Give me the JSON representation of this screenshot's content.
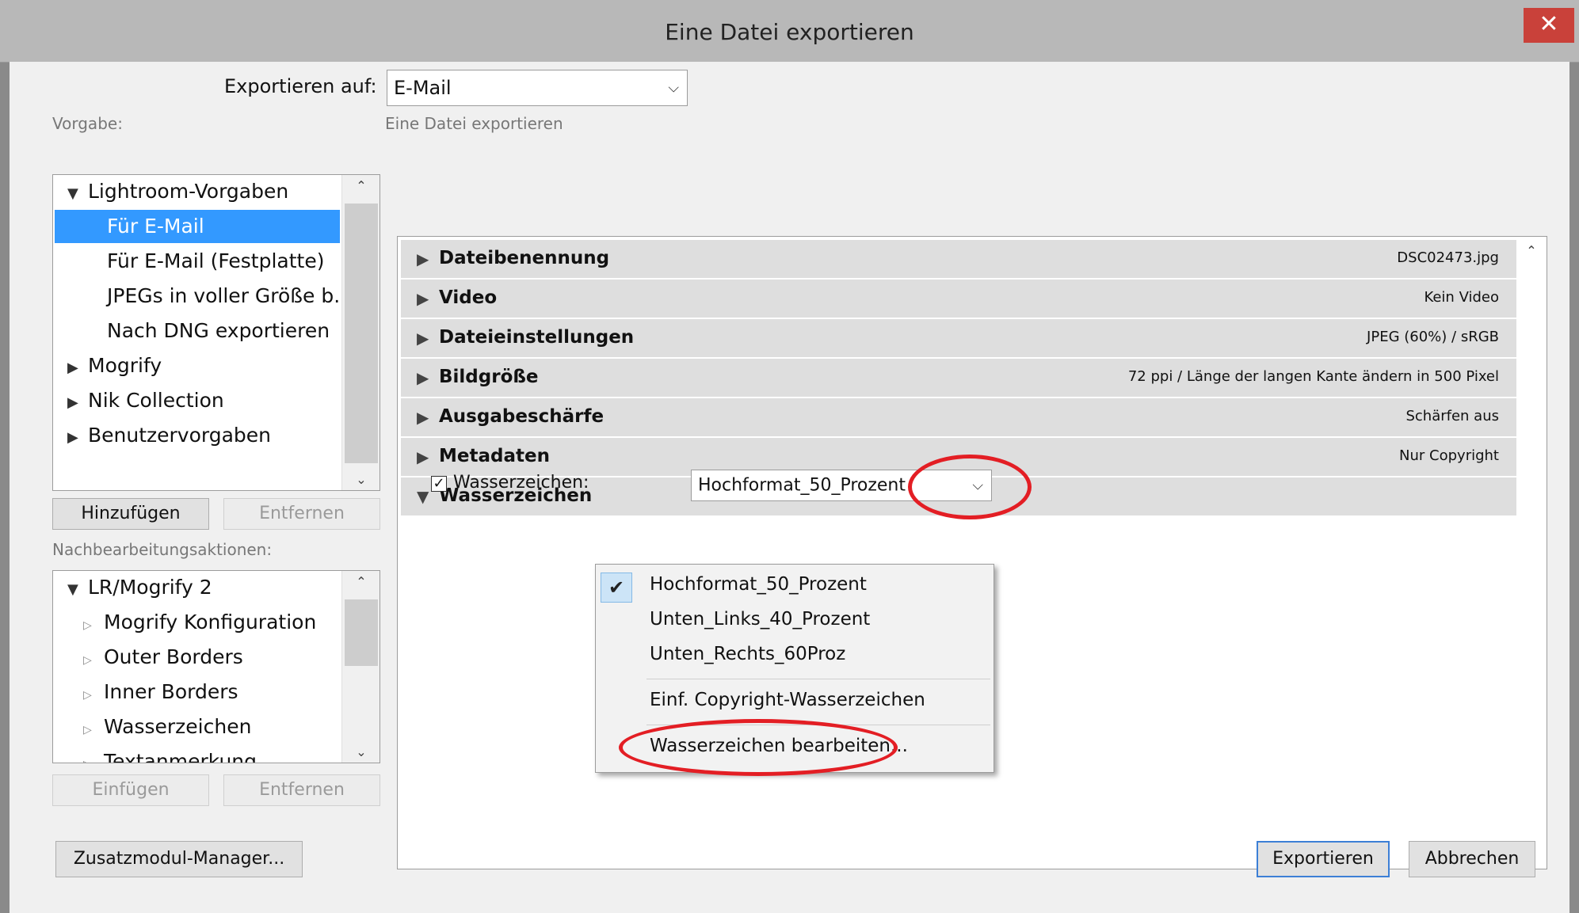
{
  "window": {
    "title": "Eine Datei exportieren",
    "close_glyph": "✕"
  },
  "export_to": {
    "label": "Exportieren auf:",
    "value": "E-Mail"
  },
  "presets": {
    "label": "Vorgabe:",
    "items": [
      {
        "label": "Lightroom-Vorgaben",
        "toggle": "▼"
      },
      {
        "label": "Für E-Mail"
      },
      {
        "label": "Für E-Mail (Festplatte)"
      },
      {
        "label": "JPEGs in voller Größe b..."
      },
      {
        "label": "Nach DNG exportieren"
      },
      {
        "label": "Mogrify",
        "toggle": "▶"
      },
      {
        "label": "Nik Collection",
        "toggle": "▶"
      },
      {
        "label": "Benutzervorgaben",
        "toggle": "▶"
      }
    ],
    "add_label": "Hinzufügen",
    "remove_label": "Entfernen"
  },
  "post_actions": {
    "label": "Nachbearbeitungsaktionen:",
    "items": [
      {
        "label": "LR/Mogrify 2",
        "toggle": "▼"
      },
      {
        "label": "Mogrify Konfiguration",
        "toggle": "▷"
      },
      {
        "label": "Outer Borders",
        "toggle": "▷"
      },
      {
        "label": "Inner Borders",
        "toggle": "▷"
      },
      {
        "label": "Wasserzeichen",
        "toggle": "▷"
      },
      {
        "label": "Textanmerkung",
        "toggle": "▷"
      }
    ],
    "insert_label": "Einfügen",
    "remove_label": "Entfernen"
  },
  "main": {
    "heading": "Eine Datei exportieren",
    "sections": [
      {
        "name": "Dateibenennung",
        "value": "DSC02473.jpg",
        "toggle": "▶"
      },
      {
        "name": "Video",
        "value": "Kein Video",
        "toggle": "▶"
      },
      {
        "name": "Dateieinstellungen",
        "value": "JPEG (60%) / sRGB",
        "toggle": "▶"
      },
      {
        "name": "Bildgröße",
        "value": "72 ppi / Länge der langen Kante ändern in 500 Pixel",
        "toggle": "▶"
      },
      {
        "name": "Ausgabeschärfe",
        "value": "Schärfen aus",
        "toggle": "▶"
      },
      {
        "name": "Metadaten",
        "value": "Nur Copyright",
        "toggle": "▶"
      },
      {
        "name": "Wasserzeichen",
        "value": "",
        "toggle": "▼"
      }
    ],
    "watermark": {
      "label": "Wasserzeichen:",
      "checked": true,
      "check_glyph": "✓",
      "selected": "Hochformat_50_Prozent",
      "options": [
        {
          "label": "Hochformat_50_Prozent",
          "checked": true
        },
        {
          "label": "Unten_Links_40_Prozent"
        },
        {
          "label": "Unten_Rechts_60Proz"
        },
        {
          "label": "Einf. Copyright-Wasserzeichen"
        },
        {
          "label": "Wasserzeichen bearbeiten..."
        }
      ]
    }
  },
  "footer": {
    "plugin_manager_label": "Zusatzmodul-Manager...",
    "export_label": "Exportieren",
    "cancel_label": "Abbrechen"
  },
  "colors": {
    "selection": "#3399ff",
    "annotation_ring": "#e31e24",
    "close": "#c9413a"
  }
}
